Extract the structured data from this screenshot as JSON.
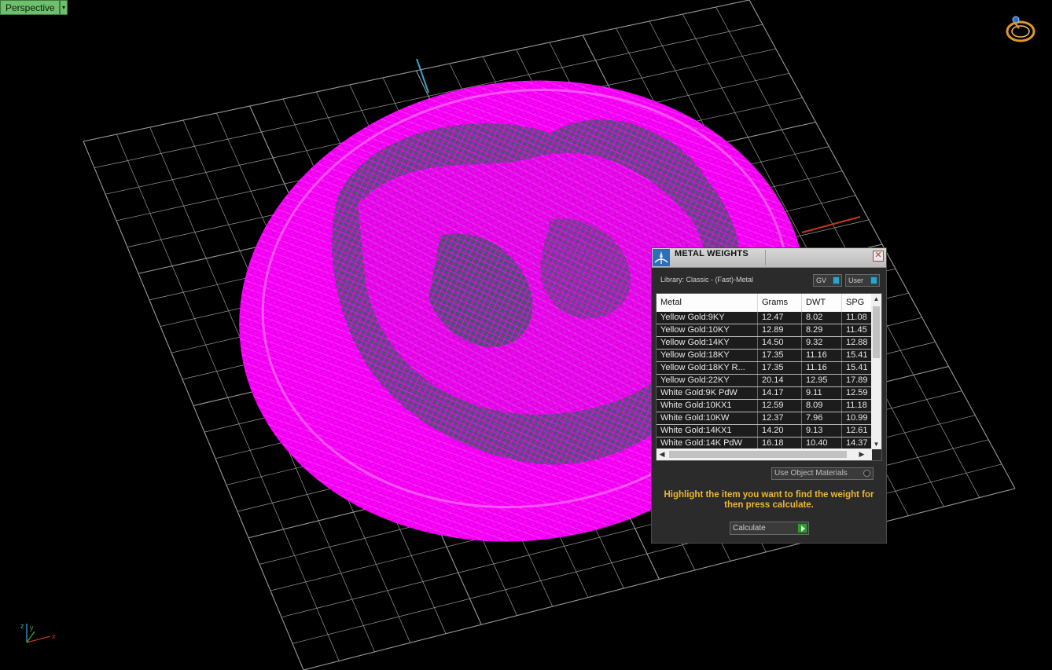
{
  "viewport": {
    "label": "Perspective",
    "menu_arrow": "▾",
    "model_color": "#ff00ff",
    "grid_color": "#9a9a9a"
  },
  "axis_gizmo": {
    "x": "x",
    "y": "y",
    "z": "z"
  },
  "panel": {
    "title": "METAL WEIGHTS",
    "close_glyph": "✕",
    "library_label": "Library: Classic - (Fast)-Metal",
    "toggles": {
      "gv": "GV",
      "user": "User"
    },
    "columns": [
      "Metal",
      "Grams",
      "DWT",
      "SPG"
    ],
    "rows": [
      [
        "Yellow Gold:9KY",
        "12.47",
        "8.02",
        "11.08"
      ],
      [
        "Yellow Gold:10KY",
        "12.89",
        "8.29",
        "11.45"
      ],
      [
        "Yellow Gold:14KY",
        "14.50",
        "9.32",
        "12.88"
      ],
      [
        "Yellow Gold:18KY",
        "17.35",
        "11.16",
        "15.41"
      ],
      [
        "Yellow Gold:18KY R...",
        "17.35",
        "11.16",
        "15.41"
      ],
      [
        "Yellow Gold:22KY",
        "20.14",
        "12.95",
        "17.89"
      ],
      [
        "White Gold:9K PdW",
        "14.17",
        "9.11",
        "12.59"
      ],
      [
        "White Gold:10KX1",
        "12.59",
        "8.09",
        "11.18"
      ],
      [
        "White Gold:10KW",
        "12.37",
        "7.96",
        "10.99"
      ],
      [
        "White Gold:14KX1",
        "14.20",
        "9.13",
        "12.61"
      ],
      [
        "White Gold:14K PdW",
        "16.18",
        "10.40",
        "14.37"
      ]
    ],
    "use_object_materials": "Use Object Materials",
    "hint": "Highlight the item you want to find the weight for then press calculate.",
    "calculate_label": "Calculate",
    "accent_color": "#f0b62c"
  }
}
